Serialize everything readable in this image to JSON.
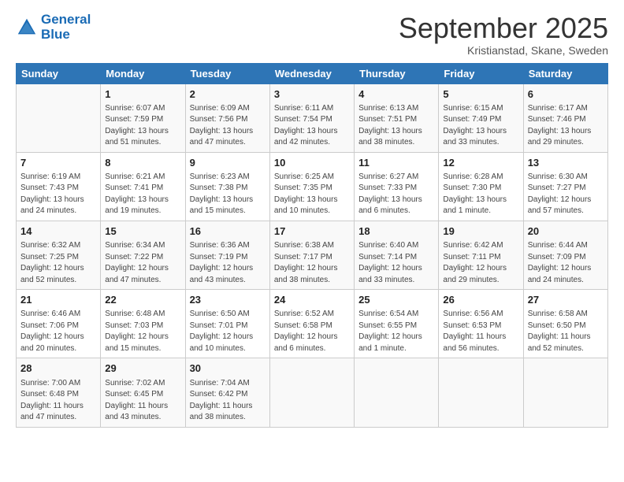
{
  "logo": {
    "line1": "General",
    "line2": "Blue"
  },
  "title": "September 2025",
  "subtitle": "Kristianstad, Skane, Sweden",
  "days_of_week": [
    "Sunday",
    "Monday",
    "Tuesday",
    "Wednesday",
    "Thursday",
    "Friday",
    "Saturday"
  ],
  "weeks": [
    [
      {
        "day": "",
        "sunrise": "",
        "sunset": "",
        "daylight": ""
      },
      {
        "day": "1",
        "sunrise": "Sunrise: 6:07 AM",
        "sunset": "Sunset: 7:59 PM",
        "daylight": "Daylight: 13 hours and 51 minutes."
      },
      {
        "day": "2",
        "sunrise": "Sunrise: 6:09 AM",
        "sunset": "Sunset: 7:56 PM",
        "daylight": "Daylight: 13 hours and 47 minutes."
      },
      {
        "day": "3",
        "sunrise": "Sunrise: 6:11 AM",
        "sunset": "Sunset: 7:54 PM",
        "daylight": "Daylight: 13 hours and 42 minutes."
      },
      {
        "day": "4",
        "sunrise": "Sunrise: 6:13 AM",
        "sunset": "Sunset: 7:51 PM",
        "daylight": "Daylight: 13 hours and 38 minutes."
      },
      {
        "day": "5",
        "sunrise": "Sunrise: 6:15 AM",
        "sunset": "Sunset: 7:49 PM",
        "daylight": "Daylight: 13 hours and 33 minutes."
      },
      {
        "day": "6",
        "sunrise": "Sunrise: 6:17 AM",
        "sunset": "Sunset: 7:46 PM",
        "daylight": "Daylight: 13 hours and 29 minutes."
      }
    ],
    [
      {
        "day": "7",
        "sunrise": "Sunrise: 6:19 AM",
        "sunset": "Sunset: 7:43 PM",
        "daylight": "Daylight: 13 hours and 24 minutes."
      },
      {
        "day": "8",
        "sunrise": "Sunrise: 6:21 AM",
        "sunset": "Sunset: 7:41 PM",
        "daylight": "Daylight: 13 hours and 19 minutes."
      },
      {
        "day": "9",
        "sunrise": "Sunrise: 6:23 AM",
        "sunset": "Sunset: 7:38 PM",
        "daylight": "Daylight: 13 hours and 15 minutes."
      },
      {
        "day": "10",
        "sunrise": "Sunrise: 6:25 AM",
        "sunset": "Sunset: 7:35 PM",
        "daylight": "Daylight: 13 hours and 10 minutes."
      },
      {
        "day": "11",
        "sunrise": "Sunrise: 6:27 AM",
        "sunset": "Sunset: 7:33 PM",
        "daylight": "Daylight: 13 hours and 6 minutes."
      },
      {
        "day": "12",
        "sunrise": "Sunrise: 6:28 AM",
        "sunset": "Sunset: 7:30 PM",
        "daylight": "Daylight: 13 hours and 1 minute."
      },
      {
        "day": "13",
        "sunrise": "Sunrise: 6:30 AM",
        "sunset": "Sunset: 7:27 PM",
        "daylight": "Daylight: 12 hours and 57 minutes."
      }
    ],
    [
      {
        "day": "14",
        "sunrise": "Sunrise: 6:32 AM",
        "sunset": "Sunset: 7:25 PM",
        "daylight": "Daylight: 12 hours and 52 minutes."
      },
      {
        "day": "15",
        "sunrise": "Sunrise: 6:34 AM",
        "sunset": "Sunset: 7:22 PM",
        "daylight": "Daylight: 12 hours and 47 minutes."
      },
      {
        "day": "16",
        "sunrise": "Sunrise: 6:36 AM",
        "sunset": "Sunset: 7:19 PM",
        "daylight": "Daylight: 12 hours and 43 minutes."
      },
      {
        "day": "17",
        "sunrise": "Sunrise: 6:38 AM",
        "sunset": "Sunset: 7:17 PM",
        "daylight": "Daylight: 12 hours and 38 minutes."
      },
      {
        "day": "18",
        "sunrise": "Sunrise: 6:40 AM",
        "sunset": "Sunset: 7:14 PM",
        "daylight": "Daylight: 12 hours and 33 minutes."
      },
      {
        "day": "19",
        "sunrise": "Sunrise: 6:42 AM",
        "sunset": "Sunset: 7:11 PM",
        "daylight": "Daylight: 12 hours and 29 minutes."
      },
      {
        "day": "20",
        "sunrise": "Sunrise: 6:44 AM",
        "sunset": "Sunset: 7:09 PM",
        "daylight": "Daylight: 12 hours and 24 minutes."
      }
    ],
    [
      {
        "day": "21",
        "sunrise": "Sunrise: 6:46 AM",
        "sunset": "Sunset: 7:06 PM",
        "daylight": "Daylight: 12 hours and 20 minutes."
      },
      {
        "day": "22",
        "sunrise": "Sunrise: 6:48 AM",
        "sunset": "Sunset: 7:03 PM",
        "daylight": "Daylight: 12 hours and 15 minutes."
      },
      {
        "day": "23",
        "sunrise": "Sunrise: 6:50 AM",
        "sunset": "Sunset: 7:01 PM",
        "daylight": "Daylight: 12 hours and 10 minutes."
      },
      {
        "day": "24",
        "sunrise": "Sunrise: 6:52 AM",
        "sunset": "Sunset: 6:58 PM",
        "daylight": "Daylight: 12 hours and 6 minutes."
      },
      {
        "day": "25",
        "sunrise": "Sunrise: 6:54 AM",
        "sunset": "Sunset: 6:55 PM",
        "daylight": "Daylight: 12 hours and 1 minute."
      },
      {
        "day": "26",
        "sunrise": "Sunrise: 6:56 AM",
        "sunset": "Sunset: 6:53 PM",
        "daylight": "Daylight: 11 hours and 56 minutes."
      },
      {
        "day": "27",
        "sunrise": "Sunrise: 6:58 AM",
        "sunset": "Sunset: 6:50 PM",
        "daylight": "Daylight: 11 hours and 52 minutes."
      }
    ],
    [
      {
        "day": "28",
        "sunrise": "Sunrise: 7:00 AM",
        "sunset": "Sunset: 6:48 PM",
        "daylight": "Daylight: 11 hours and 47 minutes."
      },
      {
        "day": "29",
        "sunrise": "Sunrise: 7:02 AM",
        "sunset": "Sunset: 6:45 PM",
        "daylight": "Daylight: 11 hours and 43 minutes."
      },
      {
        "day": "30",
        "sunrise": "Sunrise: 7:04 AM",
        "sunset": "Sunset: 6:42 PM",
        "daylight": "Daylight: 11 hours and 38 minutes."
      },
      {
        "day": "",
        "sunrise": "",
        "sunset": "",
        "daylight": ""
      },
      {
        "day": "",
        "sunrise": "",
        "sunset": "",
        "daylight": ""
      },
      {
        "day": "",
        "sunrise": "",
        "sunset": "",
        "daylight": ""
      },
      {
        "day": "",
        "sunrise": "",
        "sunset": "",
        "daylight": ""
      }
    ]
  ]
}
